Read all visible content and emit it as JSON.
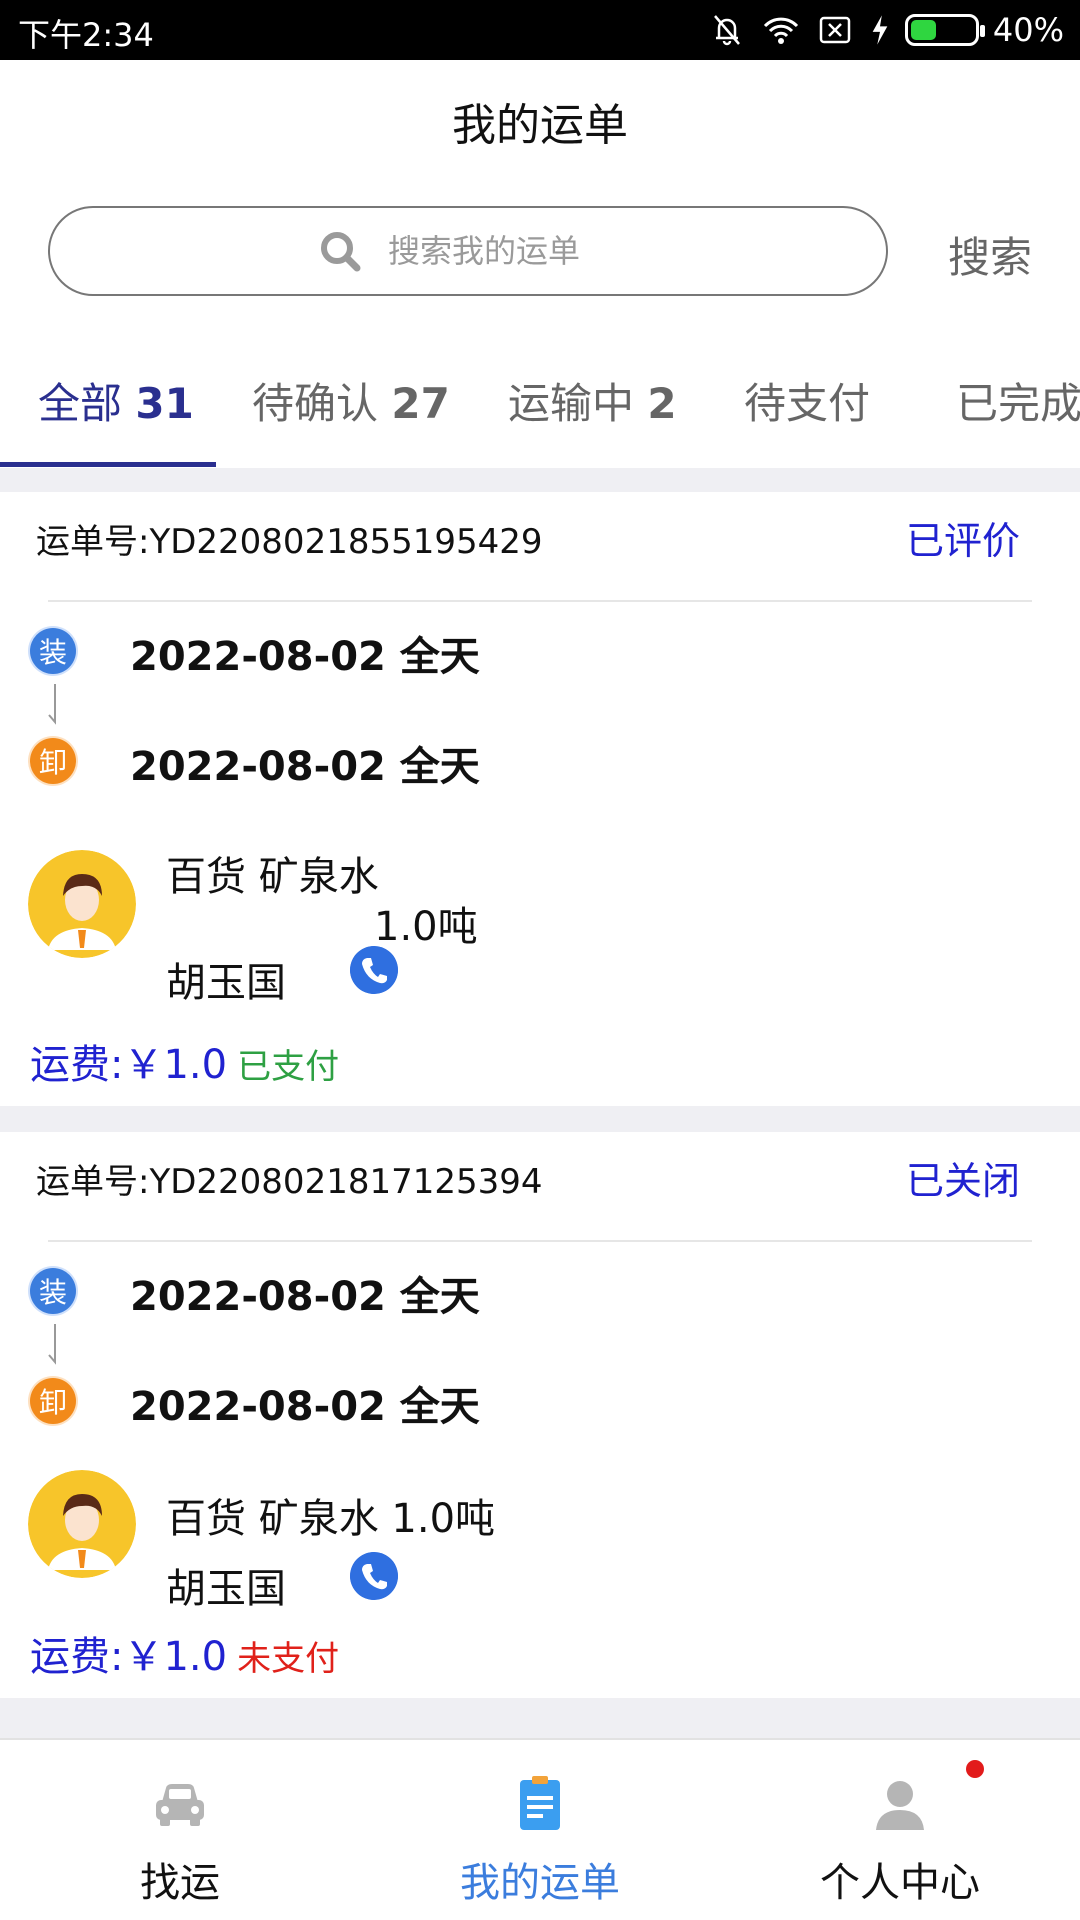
{
  "status_bar": {
    "time": "下午2:34",
    "battery": "40%",
    "battery_level": 0.4
  },
  "header": {
    "title": "我的运单"
  },
  "search": {
    "placeholder": "搜索我的运单",
    "button_label": "搜索"
  },
  "tabs": [
    {
      "label": "全部",
      "count": "31",
      "active": true
    },
    {
      "label": "待确认",
      "count": "27"
    },
    {
      "label": "运输中",
      "count": "2"
    },
    {
      "label": "待支付",
      "count": ""
    },
    {
      "label": "已完成",
      "count": ""
    }
  ],
  "orders": [
    {
      "number": "运单号:YD2208021855195429",
      "status": "已评价",
      "load_badge": "装",
      "load_date": "2022-08-02 全天",
      "unload_badge": "卸",
      "unload_date": "2022-08-02 全天",
      "cargo": "百货  矿泉水",
      "weight": "1.0吨",
      "driver": "胡玉国",
      "fee": "运费:￥1.0",
      "pay_status": "已支付"
    },
    {
      "number": "运单号:YD2208021817125394",
      "status": "已关闭",
      "load_badge": "装",
      "load_date": "2022-08-02 全天",
      "unload_badge": "卸",
      "unload_date": "2022-08-02 全天",
      "cargo": "百货  矿泉水 1.0吨",
      "driver": "胡玉国",
      "fee": "运费:￥1.0",
      "pay_status": "未支付"
    }
  ],
  "bottom_nav": [
    {
      "label": "找运",
      "icon": "car-icon"
    },
    {
      "label": "我的运单",
      "icon": "waybill-icon",
      "active": true
    },
    {
      "label": "个人中心",
      "icon": "person-icon"
    }
  ],
  "colors": {
    "accent": "#2a2f8f",
    "link_blue": "#2022d0",
    "paid": "#2ea043",
    "unpaid": "#e0211a",
    "nav_active": "#3b7ddd"
  }
}
